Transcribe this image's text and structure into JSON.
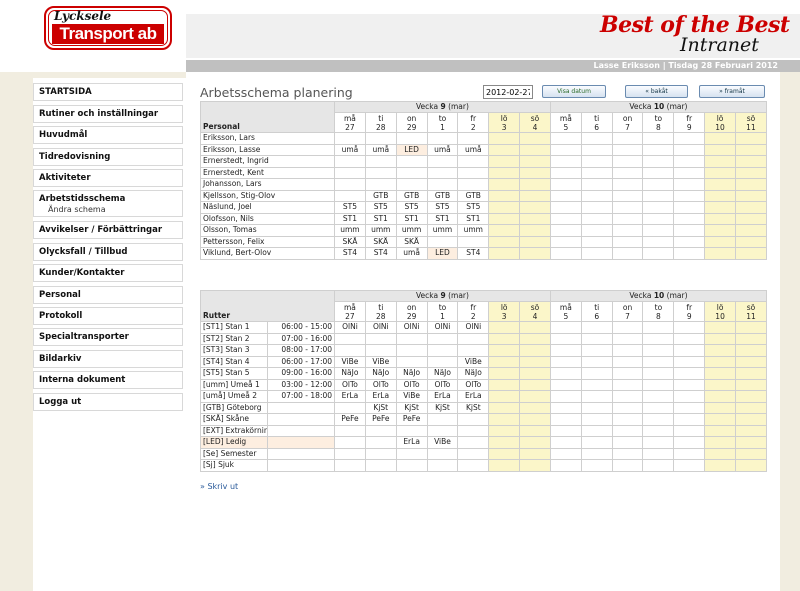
{
  "header": {
    "logo_top": "Lycksele",
    "logo_bottom": "Transport ab",
    "brand_title": "Best of the Best",
    "brand_sub": "Intranet",
    "user_info": "Lasse Eriksson | Tisdag 28 Februari 2012"
  },
  "sidebar": {
    "items": [
      {
        "label": "STARTSIDA"
      },
      {
        "label": "Rutiner och inställningar"
      },
      {
        "label": "Huvudmål"
      },
      {
        "label": "Tidredovisning"
      },
      {
        "label": "Aktiviteter"
      },
      {
        "label": "Arbetstidsschema",
        "sub": "Ändra schema"
      },
      {
        "label": "Avvikelser / Förbättringar"
      },
      {
        "label": "Olycksfall / Tillbud"
      },
      {
        "label": "Kunder/Kontakter"
      },
      {
        "label": "Personal"
      },
      {
        "label": "Protokoll"
      },
      {
        "label": "Specialtransporter"
      },
      {
        "label": "Bildarkiv"
      },
      {
        "label": "Interna dokument"
      },
      {
        "label": "Logga ut"
      }
    ]
  },
  "main": {
    "title": "Arbetsschema planering",
    "date_value": "2012-02-27",
    "btn_show": "Visa datum",
    "btn_back": "« bakåt",
    "btn_forward": "» framåt",
    "print_link": "» Skriv ut"
  },
  "weeks": [
    {
      "prefix": "Vecka ",
      "num": "9",
      "suffix": " (mar)"
    },
    {
      "prefix": "Vecka ",
      "num": "10",
      "suffix": " (mar)"
    }
  ],
  "days": [
    {
      "d": "må",
      "n": "27",
      "we": false
    },
    {
      "d": "ti",
      "n": "28",
      "we": false
    },
    {
      "d": "on",
      "n": "29",
      "we": false
    },
    {
      "d": "to",
      "n": "1",
      "we": false
    },
    {
      "d": "fr",
      "n": "2",
      "we": false
    },
    {
      "d": "lö",
      "n": "3",
      "we": true
    },
    {
      "d": "sö",
      "n": "4",
      "we": true
    },
    {
      "d": "må",
      "n": "5",
      "we": false
    },
    {
      "d": "ti",
      "n": "6",
      "we": false
    },
    {
      "d": "on",
      "n": "7",
      "we": false
    },
    {
      "d": "to",
      "n": "8",
      "we": false
    },
    {
      "d": "fr",
      "n": "9",
      "we": false
    },
    {
      "d": "lö",
      "n": "10",
      "we": true
    },
    {
      "d": "sö",
      "n": "11",
      "we": true
    }
  ],
  "personal": {
    "header": "Personal",
    "rows": [
      {
        "name": "Eriksson, Lars",
        "cells": [
          "",
          "",
          "",
          "",
          ""
        ]
      },
      {
        "name": "Eriksson, Lasse",
        "cells": [
          "umå",
          "umå",
          "LED",
          "umå",
          "umå"
        ]
      },
      {
        "name": "Ernerstedt, Ingrid",
        "cells": [
          "",
          "",
          "",
          "",
          ""
        ]
      },
      {
        "name": "Ernerstedt, Kent",
        "cells": [
          "",
          "",
          "",
          "",
          ""
        ]
      },
      {
        "name": "Johansson, Lars",
        "cells": [
          "",
          "",
          "",
          "",
          ""
        ]
      },
      {
        "name": "Kjellsson, Stig-Olov",
        "cells": [
          "",
          "GTB",
          "GTB",
          "GTB",
          "GTB"
        ]
      },
      {
        "name": "Näslund, Joel",
        "cells": [
          "ST5",
          "ST5",
          "ST5",
          "ST5",
          "ST5"
        ]
      },
      {
        "name": "Olofsson, Nils",
        "cells": [
          "ST1",
          "ST1",
          "ST1",
          "ST1",
          "ST1"
        ]
      },
      {
        "name": "Olsson, Tomas",
        "cells": [
          "umm",
          "umm",
          "umm",
          "umm",
          "umm"
        ]
      },
      {
        "name": "Pettersson, Felix",
        "cells": [
          "SKÅ",
          "SKÅ",
          "SKÅ",
          "",
          ""
        ]
      },
      {
        "name": "Viklund, Bert-Olov",
        "cells": [
          "ST4",
          "ST4",
          "umå",
          "LED",
          "ST4"
        ]
      }
    ]
  },
  "routes": {
    "header": "Rutter",
    "rows": [
      {
        "name": "[ST1] Stan 1",
        "time": "06:00 - 15:00",
        "cells": [
          "OlNi",
          "OlNi",
          "OlNi",
          "OlNi",
          "OlNi"
        ]
      },
      {
        "name": "[ST2] Stan 2",
        "time": "07:00 - 16:00",
        "cells": [
          "",
          "",
          "",
          "",
          ""
        ]
      },
      {
        "name": "[ST3] Stan 3",
        "time": "08:00 - 17:00",
        "cells": [
          "",
          "",
          "",
          "",
          ""
        ]
      },
      {
        "name": "[ST4] Stan 4",
        "time": "06:00 - 17:00",
        "cells": [
          "ViBe",
          "ViBe",
          "",
          "",
          "ViBe"
        ]
      },
      {
        "name": "[ST5] Stan 5",
        "time": "09:00 - 16:00",
        "cells": [
          "NäJo",
          "NäJo",
          "NäJo",
          "NäJo",
          "NäJo"
        ]
      },
      {
        "name": "[umm] Umeå 1",
        "time": "03:00 - 12:00",
        "cells": [
          "OlTo",
          "OlTo",
          "OlTo",
          "OlTo",
          "OlTo"
        ]
      },
      {
        "name": "[umå] Umeå 2",
        "time": "07:00 - 18:00",
        "cells": [
          "ErLa",
          "ErLa",
          "ViBe",
          "ErLa",
          "ErLa"
        ]
      },
      {
        "name": "[GTB] Göteborg",
        "time": "",
        "cells": [
          "",
          "KjSt",
          "KjSt",
          "KjSt",
          "KjSt"
        ]
      },
      {
        "name": "[SKÅ] Skåne",
        "time": "",
        "cells": [
          "PeFe",
          "PeFe",
          "PeFe",
          "",
          ""
        ]
      },
      {
        "name": "[EXT] Extrakörning",
        "time": "",
        "cells": [
          "",
          "",
          "",
          "",
          ""
        ]
      },
      {
        "name": "[LED] Ledig",
        "time": "",
        "cells": [
          "",
          "",
          "ErLa",
          "ViBe",
          ""
        ],
        "highlight": true
      },
      {
        "name": "[Se] Semester",
        "time": "",
        "cells": [
          "",
          "",
          "",
          "",
          ""
        ]
      },
      {
        "name": "[Sj] Sjuk",
        "time": "",
        "cells": [
          "",
          "",
          "",
          "",
          ""
        ]
      }
    ]
  }
}
